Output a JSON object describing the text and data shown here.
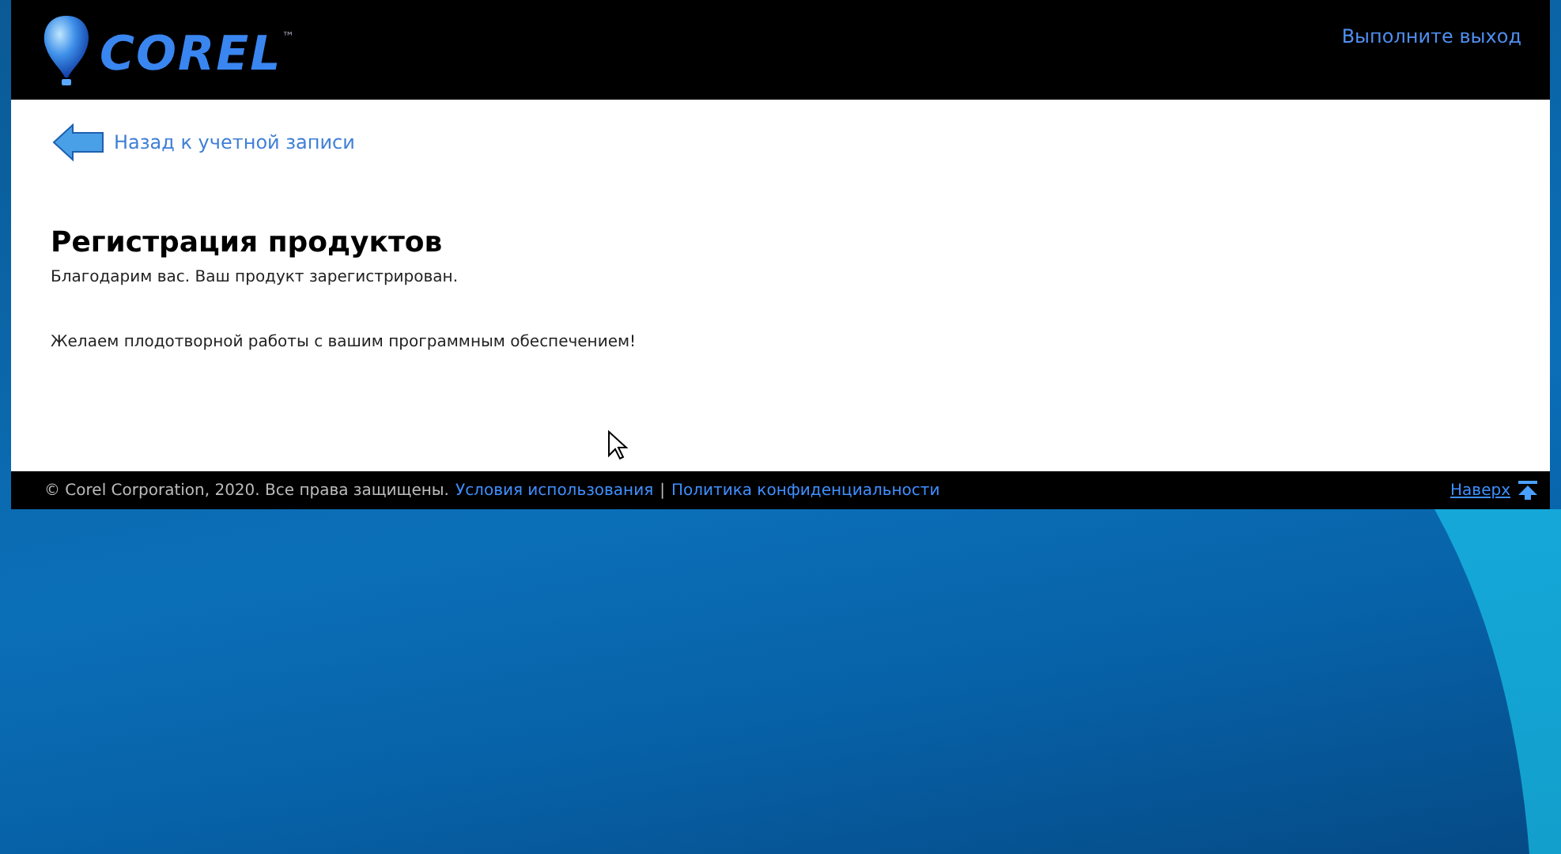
{
  "header": {
    "logo_text": "COREL",
    "logo_mark": "™",
    "signout_link": "Выполните выход"
  },
  "back_link": "Назад к учетной записи",
  "title": "Регистрация продуктов",
  "message": "Благодарим вас. Ваш продукт зарегистрирован.",
  "wish": "Желаем плодотворной работы с вашим программным обеспечением!",
  "footer": {
    "copyright": "© Corel Corporation, 2020. Все права защищены.",
    "links": [
      {
        "label": "Условия использования"
      },
      {
        "label": "Политика конфиденциальности"
      }
    ],
    "separator": "|",
    "top_link": "Наверх"
  }
}
